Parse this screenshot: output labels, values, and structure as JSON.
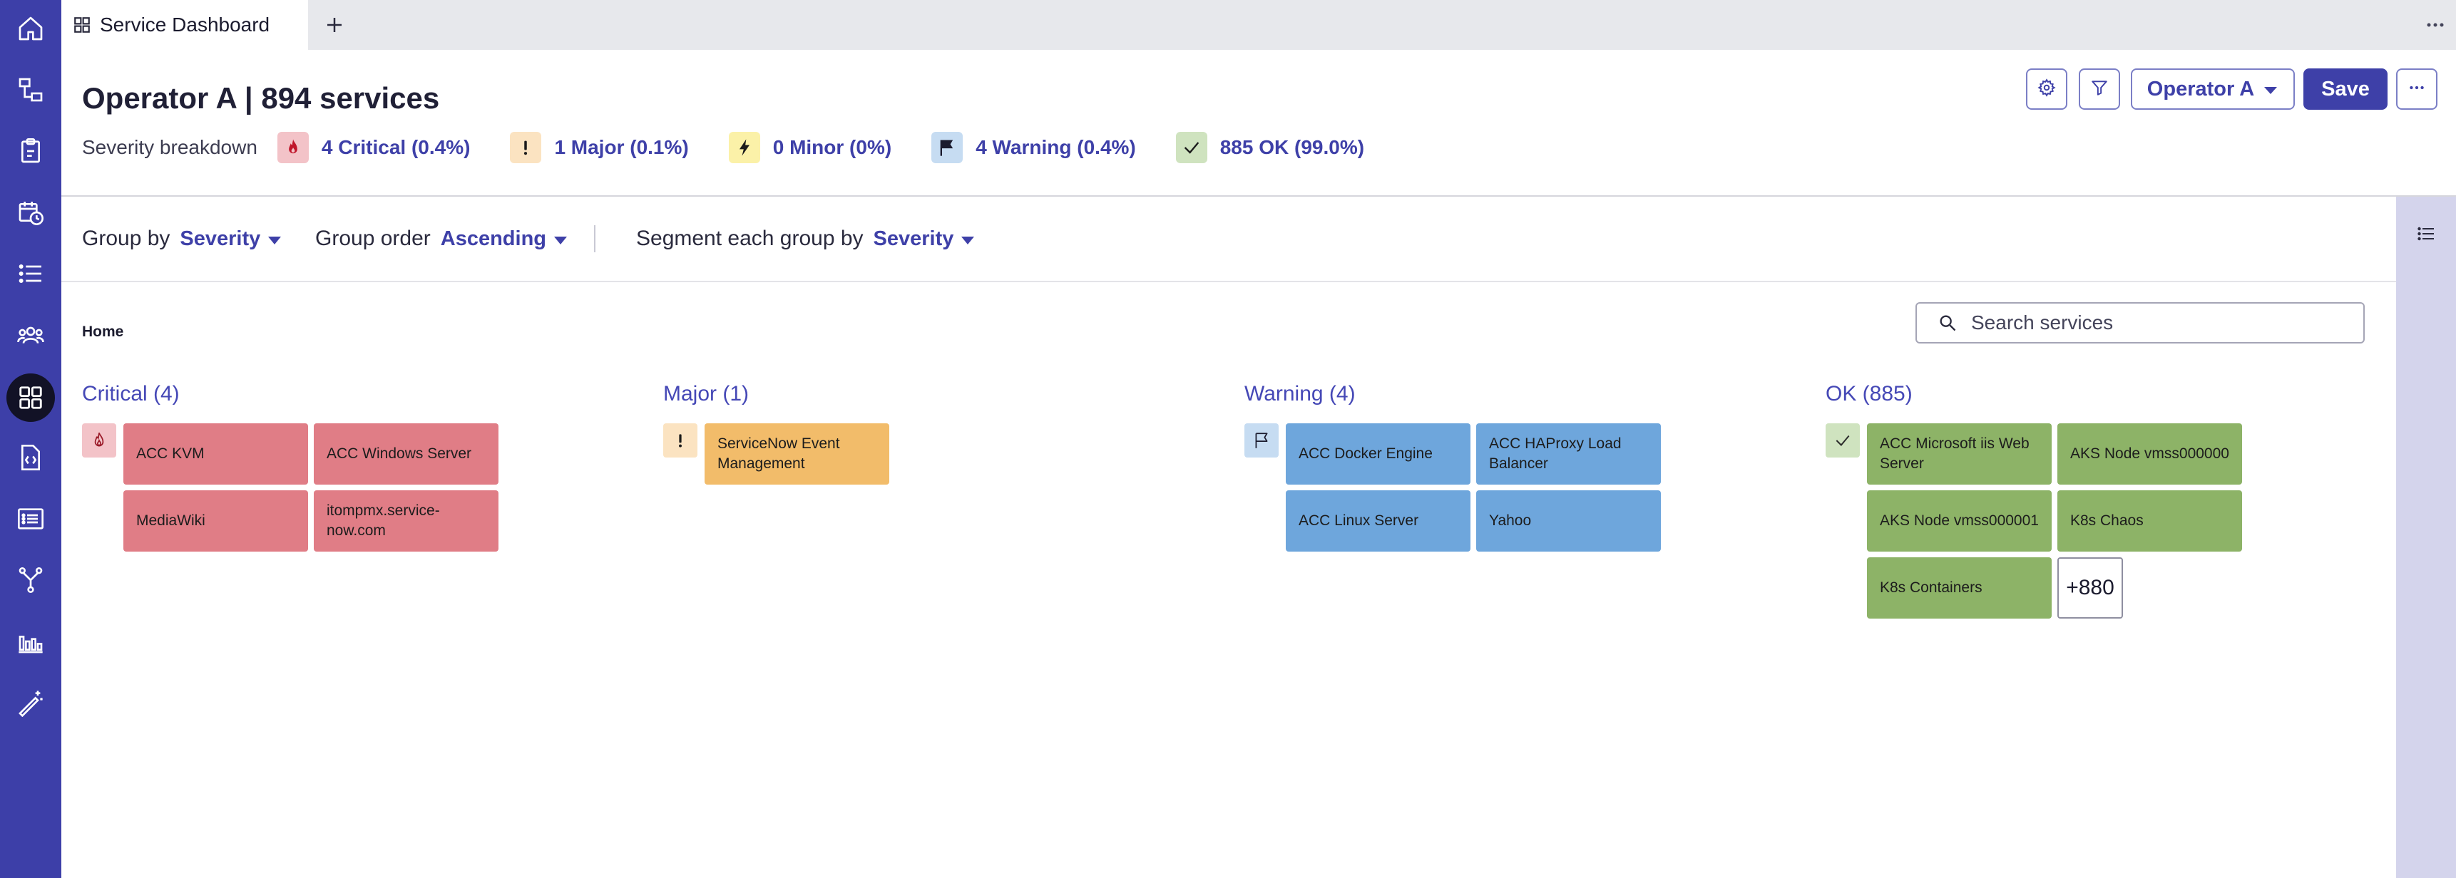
{
  "colors": {
    "brand": "#3e40a8",
    "nav_bg": "#3d3fa8",
    "critical": "#e07d86",
    "critical_icon_bg": "#f3c3c8",
    "major": "#f2bc6a",
    "major_icon_bg": "#fbe3c1",
    "minor_icon_bg": "#fbf1a8",
    "warning": "#6ea6dc",
    "warning_icon_bg": "#c6dcf2",
    "ok": "#8db367",
    "ok_icon_bg": "#cfe3bf"
  },
  "nav": {
    "items": [
      {
        "icon": "home-icon"
      },
      {
        "icon": "hierarchy-icon"
      },
      {
        "icon": "clipboard-icon"
      },
      {
        "icon": "calendar-clock-icon"
      },
      {
        "icon": "list-icon"
      },
      {
        "icon": "users-icon"
      },
      {
        "icon": "dashboard-grid-icon",
        "active": true
      },
      {
        "icon": "code-file-icon"
      },
      {
        "icon": "details-list-icon"
      },
      {
        "icon": "branch-icon"
      },
      {
        "icon": "bar-chart-icon"
      },
      {
        "icon": "magic-wand-icon"
      }
    ]
  },
  "tabs": [
    {
      "label": "Service Dashboard",
      "icon": "grid-icon",
      "active": true
    }
  ],
  "header": {
    "title": "Operator A | 894 services",
    "severity_label": "Severity breakdown",
    "severity": [
      {
        "key": "critical",
        "text": "4 Critical (0.4%)",
        "icon": "fire-icon"
      },
      {
        "key": "major",
        "text": "1 Major (0.1%)",
        "icon": "exclamation-icon"
      },
      {
        "key": "minor",
        "text": "0 Minor (0%)",
        "icon": "lightning-icon"
      },
      {
        "key": "warning",
        "text": "4 Warning (0.4%)",
        "icon": "flag-icon"
      },
      {
        "key": "ok",
        "text": "885 OK (99.0%)",
        "icon": "check-icon"
      }
    ],
    "operator_label": "Operator A",
    "save_label": "Save"
  },
  "toolbar": {
    "group_by_label": "Group by",
    "group_by_value": "Severity",
    "group_order_label": "Group order",
    "group_order_value": "Ascending",
    "segment_label": "Segment each group by",
    "segment_value": "Severity"
  },
  "breadcrumb": "Home",
  "search": {
    "placeholder": "Search services",
    "value": ""
  },
  "groups": [
    {
      "title": "Critical (4)",
      "icon": "fire-icon",
      "tiles": [
        "ACC KVM",
        "ACC Windows Server",
        "MediaWiki",
        "itompmx.service-now.com"
      ]
    },
    {
      "title": "Major (1)",
      "icon": "exclamation-icon",
      "tiles": [
        "ServiceNow Event Management"
      ]
    },
    {
      "title": "Warning (4)",
      "icon": "flag-outline-icon",
      "tiles": [
        "ACC Docker Engine",
        "ACC HAProxy Load Balancer",
        "ACC Linux Server",
        "Yahoo"
      ]
    },
    {
      "title": "OK (885)",
      "icon": "check-icon",
      "tiles": [
        "ACC Microsoft iis Web Server",
        "AKS Node vmss000000",
        "AKS Node vmss000001",
        "K8s Chaos",
        "K8s Containers"
      ],
      "more": "+880"
    }
  ]
}
